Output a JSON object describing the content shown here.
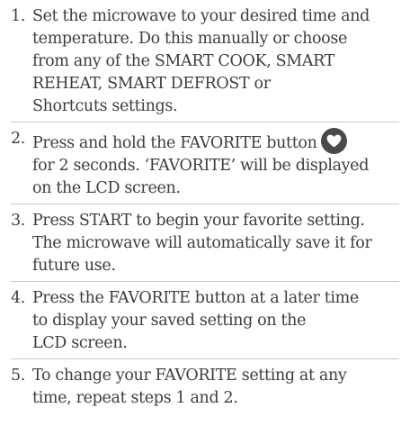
{
  "steps": [
    {
      "number": "1.",
      "lines": [
        "Set the microwave to your desired time and",
        "temperature. Do this manually or choose",
        "from any of the SMART COOK, SMART",
        "REHEAT, SMART DEFROST or",
        "Shortcuts settings."
      ]
    },
    {
      "number": "2.",
      "lines": [
        "Press and hold the FAVORITE button",
        "for 2 seconds. ‘FAVORITE’ will be displayed",
        "on the LCD screen."
      ],
      "icon": "heart-icon"
    },
    {
      "number": "3.",
      "lines": [
        "Press START to begin your favorite setting.",
        "The microwave will automatically save it for",
        "future use."
      ]
    },
    {
      "number": "4.",
      "lines": [
        "Press the FAVORITE button at a later time",
        "to display your saved setting on the",
        "LCD screen."
      ]
    },
    {
      "number": "5.",
      "lines": [
        "To change your FAVORITE setting at any",
        "time, repeat steps 1 and 2."
      ]
    }
  ]
}
